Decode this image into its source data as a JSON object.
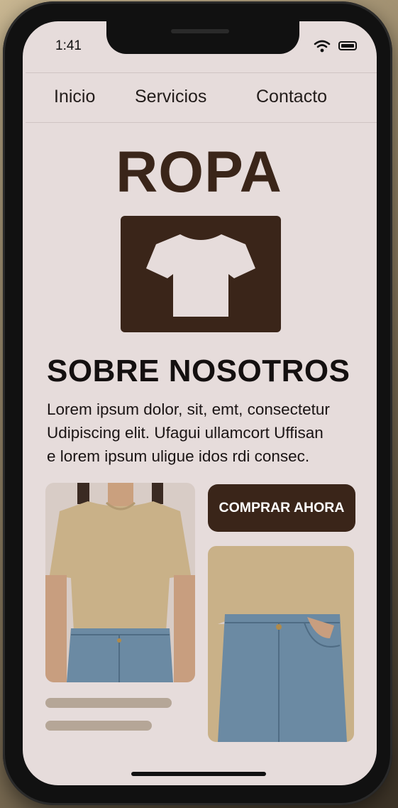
{
  "status_bar": {
    "time": "1:41"
  },
  "nav": {
    "items": [
      "Inicio",
      "Servicios",
      "Contacto"
    ]
  },
  "brand": {
    "title": "ROPA"
  },
  "about": {
    "heading": "SOBRE NOSOTROS",
    "lines": [
      "Lorem ipsum dolor, sit, emt, consectetur",
      "Udipiscing elit. Ufagui ullamcort Uffisan",
      "e lorem ipsum uligue idos rdi consec."
    ]
  },
  "cta": {
    "label": "COMPRAR AHORA"
  },
  "colors": {
    "brown": "#3a2519",
    "screen_bg": "#e6dcdb",
    "tan": "#c9b188"
  },
  "icons": {
    "logo": "tshirt-icon"
  }
}
